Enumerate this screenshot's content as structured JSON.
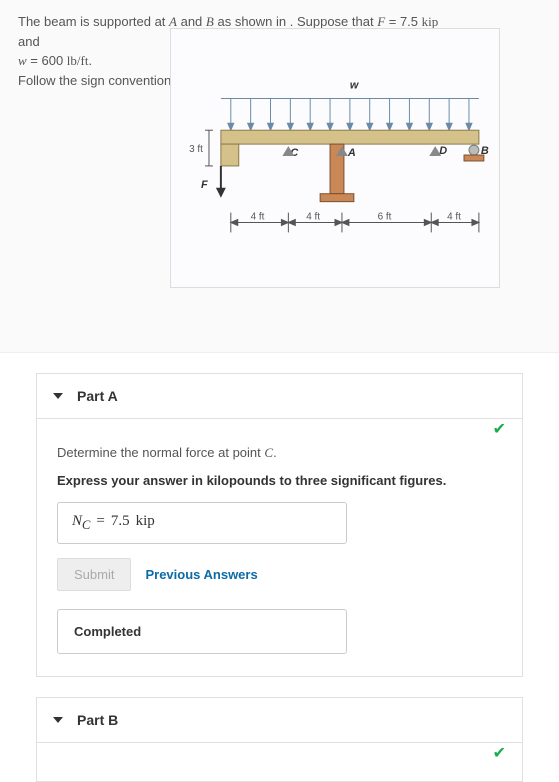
{
  "problem": {
    "line1_pre": "The beam is supported at ",
    "line1_varA": "A",
    "line1_mid": " and ",
    "line1_varB": "B",
    "line1_post": " as shown in . Suppose that ",
    "line1_F": "F",
    "line1_eq": " = 7.5 ",
    "line1_unitF": "kip",
    "line2_and": "and",
    "line3_w": "w",
    "line3_eq": " = 600 ",
    "line3_unit": "lb/ft",
    "line3_period": ".",
    "line4": "Follow the sign convention."
  },
  "figure": {
    "labels": {
      "w": "w",
      "C": "C",
      "A": "A",
      "D": "D",
      "B": "B",
      "F": "F",
      "threeft": "3 ft"
    },
    "dims": [
      "4 ft",
      "4 ft",
      "6 ft",
      "4 ft"
    ]
  },
  "partA": {
    "title": "Part A",
    "question_pre": "Determine the normal force at point ",
    "question_var": "C",
    "question_post": ".",
    "instruction": "Express your answer in kilopounds to three significant figures.",
    "answer_sym": "N",
    "answer_sub": "C",
    "answer_eq": " = ",
    "answer_val": "7.5",
    "answer_unit": " kip",
    "submit": "Submit",
    "prev": "Previous Answers",
    "status": "Completed"
  },
  "partB": {
    "title": "Part B"
  }
}
